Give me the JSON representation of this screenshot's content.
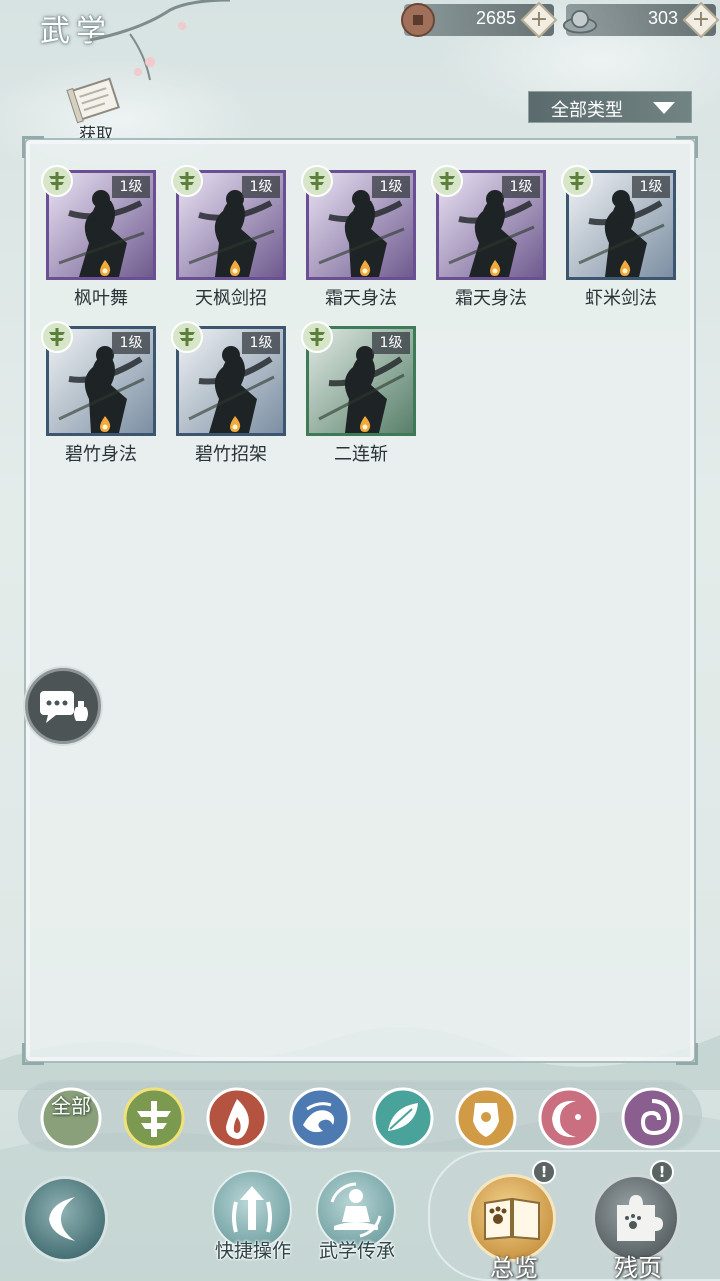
{
  "header": {
    "title": "武学",
    "copper": {
      "icon": "copper-coin-icon",
      "value": "2685"
    },
    "silver": {
      "icon": "silver-ingot-icon",
      "value": "303"
    },
    "acquire_label": "获取",
    "filter_label": "全部类型"
  },
  "skills": [
    {
      "name": "枫叶舞",
      "level": "1级",
      "rarity": "purple",
      "border": "#6b4f93"
    },
    {
      "name": "天枫剑招",
      "level": "1级",
      "rarity": "purple",
      "border": "#6b4f93"
    },
    {
      "name": "霜天身法",
      "level": "1级",
      "rarity": "purple",
      "border": "#6b4f93"
    },
    {
      "name": "霜天身法",
      "level": "1级",
      "rarity": "purple",
      "border": "#6b4f93"
    },
    {
      "name": "虾米剑法",
      "level": "1级",
      "rarity": "blue",
      "border": "#3d5670"
    },
    {
      "name": "碧竹身法",
      "level": "1级",
      "rarity": "blue",
      "border": "#3d5670"
    },
    {
      "name": "碧竹招架",
      "level": "1级",
      "rarity": "blue",
      "border": "#3d5670"
    },
    {
      "name": "二连斩",
      "level": "1级",
      "rarity": "green",
      "border": "#3f7a56"
    }
  ],
  "categories": [
    {
      "id": "all",
      "label": "全部",
      "icon": "all-category-icon",
      "color": "#8aa07a"
    },
    {
      "id": "sword",
      "label": "",
      "icon": "sword-category-icon",
      "color": "#7c9a4f"
    },
    {
      "id": "fire",
      "label": "",
      "icon": "flame-category-icon",
      "color": "#b4533f"
    },
    {
      "id": "wave",
      "label": "",
      "icon": "wave-category-icon",
      "color": "#4d7ab0"
    },
    {
      "id": "leaf",
      "label": "",
      "icon": "leaf-category-icon",
      "color": "#4aa39a"
    },
    {
      "id": "shield",
      "label": "",
      "icon": "shield-category-icon",
      "color": "#d19a44"
    },
    {
      "id": "moon",
      "label": "",
      "icon": "moon-category-icon",
      "color": "#c96f7f"
    },
    {
      "id": "spiral",
      "label": "",
      "icon": "spiral-category-icon",
      "color": "#8a5f8f"
    }
  ],
  "bottom": {
    "quick_ops_label": "快捷操作",
    "inherit_label": "武学传承",
    "overview_label": "总览",
    "fragment_label": "残页",
    "notice_mark": "!"
  }
}
